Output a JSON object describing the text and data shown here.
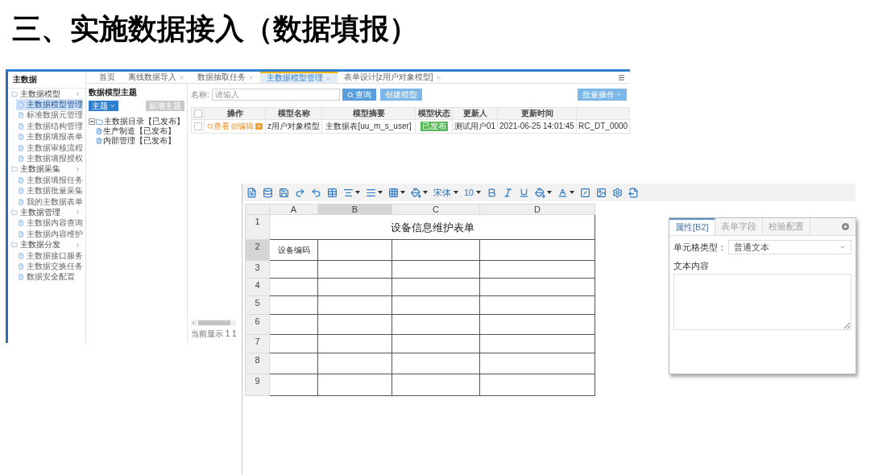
{
  "title": "三、实施数据接入（数据填报）",
  "app": {
    "sidebar": {
      "title": "主数据",
      "items": [
        {
          "label": "主数据模型",
          "children": [
            {
              "label": "主数据模型管理",
              "selected": true
            },
            {
              "label": "标准数据元管理",
              "selected": false
            },
            {
              "label": "主数据结构管理",
              "selected": false
            },
            {
              "label": "主数据填报表单",
              "selected": false
            },
            {
              "label": "主数据审核流程",
              "selected": false
            },
            {
              "label": "主数据填报授权",
              "selected": false
            }
          ]
        },
        {
          "label": "主数据采集",
          "children": [
            {
              "label": "主数据填报任务",
              "selected": false
            },
            {
              "label": "主数据批量采集",
              "selected": false
            },
            {
              "label": "我的主数据表单",
              "selected": false
            }
          ]
        },
        {
          "label": "主数据管理",
          "children": [
            {
              "label": "主数据内容查询",
              "selected": false
            },
            {
              "label": "主数据内容维护",
              "selected": false
            }
          ]
        },
        {
          "label": "主数据分发",
          "children": [
            {
              "label": "主数据接口服务",
              "selected": false
            },
            {
              "label": "主数据交换任务",
              "selected": false
            },
            {
              "label": "数据安全配置",
              "selected": false
            }
          ]
        }
      ]
    },
    "tabs": [
      {
        "label": "首页",
        "selected": false,
        "closable": false
      },
      {
        "label": "离线数据导入",
        "selected": false,
        "closable": true
      },
      {
        "label": "数据抽取任务",
        "selected": false,
        "closable": true
      },
      {
        "label": "主数据模型管理",
        "selected": true,
        "closable": true
      },
      {
        "label": "表单设计[z用户对象模型]",
        "selected": false,
        "closable": true
      }
    ],
    "theme_panel": {
      "title": "数据模型主题",
      "theme_button": "主题",
      "add_button": {
        "label": "新增主题",
        "disabled": true
      },
      "tree": [
        {
          "label": "主数据目录【已发布】",
          "expanded": true,
          "children": [
            {
              "label": "生产制造【已发布】"
            },
            {
              "label": "内部管理【已发布】"
            }
          ]
        }
      ]
    },
    "model_list": {
      "name_label": "名称:",
      "search": {
        "placeholder": "请输入"
      },
      "query_button": "查询",
      "create_button": "创建模型",
      "batch_button": "批量操作",
      "table": {
        "select_all_checked": false,
        "columns": [
          "操作",
          "模型名称",
          "模型摘要",
          "模型状态",
          "更新人",
          "更新时间"
        ],
        "rows": [
          {
            "checked": false,
            "view": "查看",
            "edit": "编辑",
            "model_name": "z用户对象模型",
            "summary": "主数据表[uu_m_s_user]",
            "status": "已发布",
            "updated_by": "测试用户01",
            "updated_at": "2021-06-25 14:01:45",
            "column_8": "RC_DT_0000"
          }
        ]
      },
      "footer": "当前显示 1 1"
    }
  },
  "designer": {
    "toolbar": {
      "font": "宋体",
      "font_size": "10"
    },
    "sheet": {
      "columns": [
        {
          "label": "A",
          "selected": false
        },
        {
          "label": "B",
          "selected": true
        },
        {
          "label": "C",
          "selected": false
        },
        {
          "label": "D",
          "selected": false
        }
      ],
      "rows": [
        {
          "label": "1",
          "selected": false,
          "kind": "title",
          "title": "设备信息维护表单"
        },
        {
          "label": "2",
          "selected": true,
          "kind": "data",
          "cells": [
            "设备编码"
          ]
        },
        {
          "label": "3",
          "selected": false,
          "kind": "data"
        },
        {
          "label": "4",
          "selected": false,
          "kind": "data"
        },
        {
          "label": "5",
          "selected": false,
          "kind": "data"
        },
        {
          "label": "6",
          "selected": false,
          "kind": "data"
        },
        {
          "label": "7",
          "selected": false,
          "kind": "data"
        },
        {
          "label": "8",
          "selected": false,
          "kind": "data"
        },
        {
          "label": "9",
          "selected": false,
          "kind": "data"
        }
      ]
    }
  },
  "properties": {
    "tabs": [
      {
        "label": "属性[B2]",
        "selected": true
      },
      {
        "label": "表单字段",
        "selected": false
      },
      {
        "label": "校验配置",
        "selected": false
      }
    ],
    "cell_type_label": "单元格类型：",
    "cell_type": "普通文本",
    "content_label": "文本内容"
  }
}
